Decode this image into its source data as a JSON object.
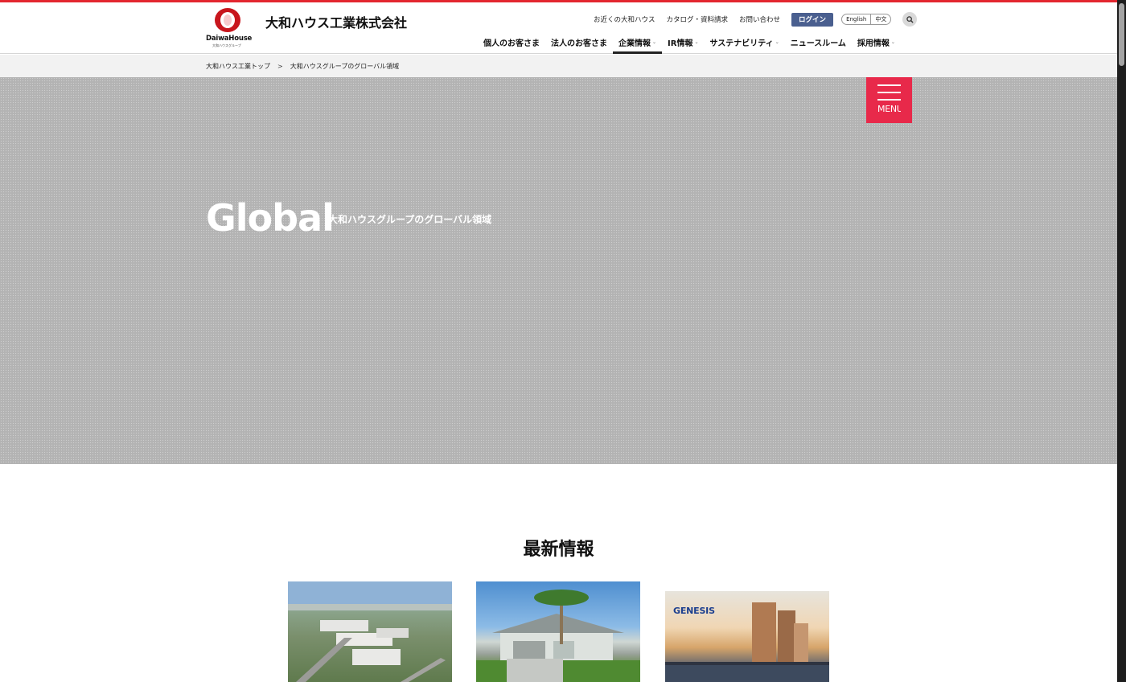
{
  "header": {
    "logo_wordmark": "DaiwaHouse",
    "logo_group": "大和ハウスグループ",
    "company_name": "大和ハウス工業株式会社",
    "util_links": [
      "お近くの大和ハウス",
      "カタログ・資料請求",
      "お問い合わせ"
    ],
    "login_label": "ログイン",
    "languages": [
      "English",
      "中文"
    ],
    "search_icon": "search-icon",
    "nav": [
      {
        "label": "個人のお客さま",
        "dropdown": false,
        "active": false
      },
      {
        "label": "法人のお客さま",
        "dropdown": false,
        "active": false
      },
      {
        "label": "企業情報",
        "dropdown": true,
        "active": true
      },
      {
        "label": "IR情報",
        "dropdown": true,
        "active": false
      },
      {
        "label": "サステナビリティ",
        "dropdown": true,
        "active": false
      },
      {
        "label": "ニュースルーム",
        "dropdown": false,
        "active": false
      },
      {
        "label": "採用情報",
        "dropdown": true,
        "active": false
      }
    ]
  },
  "breadcrumb": {
    "items": [
      "大和ハウス工業トップ",
      "大和ハウスグループのグローバル領域"
    ],
    "separator": ">"
  },
  "hero": {
    "title": "Global",
    "subtitle": "大和ハウスグループのグローバル領域",
    "menu_label": "MENU"
  },
  "news": {
    "heading": "最新情報",
    "cards": [
      {
        "image": "aerial-industrial-park-photo"
      },
      {
        "image": "palm-tree-house-photo"
      },
      {
        "image": "genesis-towers-photo",
        "logo_text": "GENESIS"
      }
    ]
  },
  "colors": {
    "accent_red": "#e3262f",
    "menu_red": "#e8294a",
    "login_blue": "#4a5f8f",
    "hero_gray": "#b3b3b3"
  }
}
